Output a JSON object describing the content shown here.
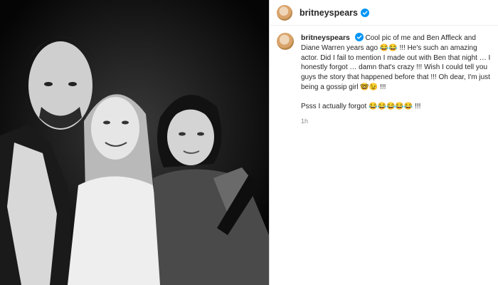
{
  "post": {
    "image_alt": "Black and white photo of three people smiling"
  },
  "header": {
    "username": "britneyspears"
  },
  "caption": {
    "username": "britneyspears",
    "text": "Cool pic of me and Ben Affleck and Diane Warren years ago 😂😂 !!! He's such an amazing actor. Did I fail to mention I made out with Ben that night … I honestly forgot … damn that's crazy !!! Wish I could tell you guys the story that happened before that !!! Oh dear, I'm just being a gossip girl 🤓😉 !!!",
    "text2": "Psss I actually forgot 😂😂😂😂😂 !!!",
    "timestamp": "1h"
  },
  "colors": {
    "verified": "#0095f6",
    "text": "#262626",
    "secondary": "#8e8e8e"
  }
}
